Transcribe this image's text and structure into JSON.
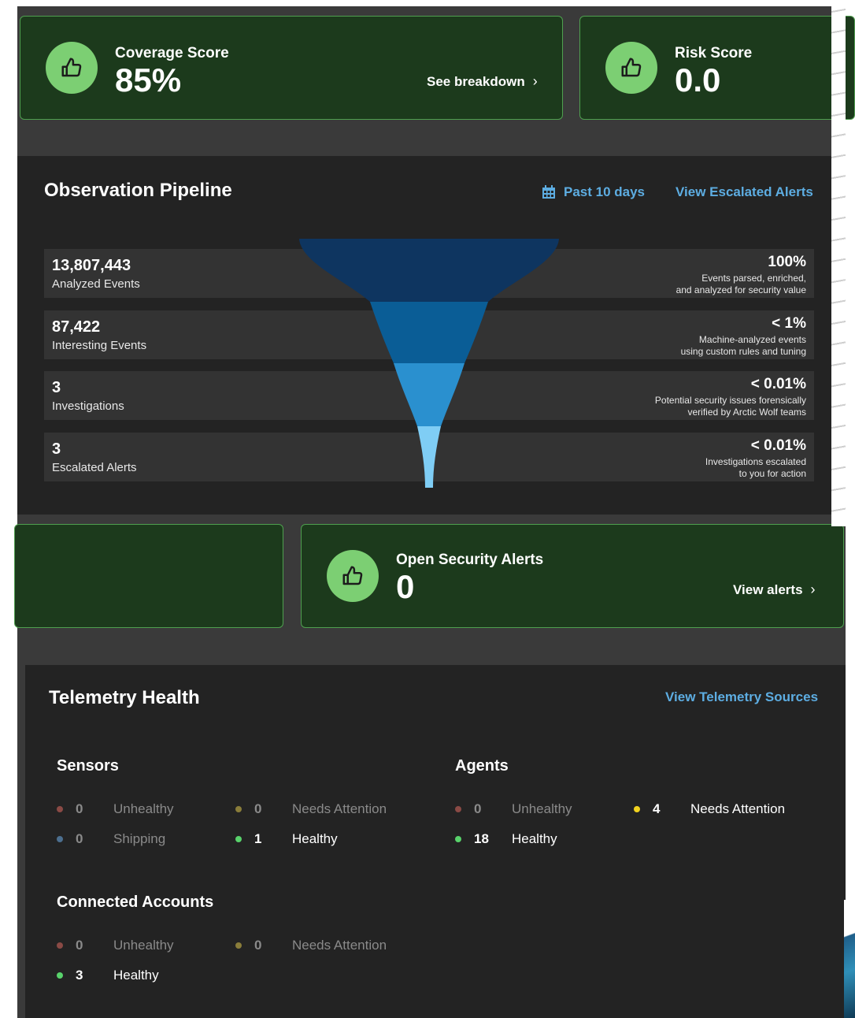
{
  "coverage_card": {
    "title": "Coverage Score",
    "value": "85%",
    "link": "See breakdown"
  },
  "risk_card": {
    "title": "Risk Score",
    "value": "0.0"
  },
  "pipeline": {
    "title": "Observation Pipeline",
    "date_range": "Past 10 days",
    "escalated_link": "View Escalated Alerts",
    "rows": [
      {
        "count": "13,807,443",
        "label": "Analyzed Events",
        "pct": "100%",
        "desc1": "Events parsed, enriched,",
        "desc2": "and analyzed for security value"
      },
      {
        "count": "87,422",
        "label": "Interesting Events",
        "pct": "< 1%",
        "desc1": "Machine-analyzed events",
        "desc2": "using custom rules and tuning"
      },
      {
        "count": "3",
        "label": "Investigations",
        "pct": "< 0.01%",
        "desc1": "Potential security issues forensically",
        "desc2": "verified by Arctic Wolf teams"
      },
      {
        "count": "3",
        "label": "Escalated Alerts",
        "pct": "< 0.01%",
        "desc1": "Investigations escalated",
        "desc2": "to you for action"
      }
    ],
    "funnel_colors": [
      "#0e3560",
      "#0a5d96",
      "#2a90cf",
      "#7fcdf5"
    ]
  },
  "alerts_card": {
    "title": "Open Security Alerts",
    "value": "0",
    "link": "View alerts"
  },
  "telemetry": {
    "title": "Telemetry Health",
    "sources_link": "View Telemetry Sources",
    "sensors": {
      "title": "Sensors",
      "unhealthy": {
        "count": "0",
        "label": "Unhealthy"
      },
      "needs_attention": {
        "count": "0",
        "label": "Needs Attention"
      },
      "shipping": {
        "count": "0",
        "label": "Shipping"
      },
      "healthy": {
        "count": "1",
        "label": "Healthy"
      }
    },
    "agents": {
      "title": "Agents",
      "unhealthy": {
        "count": "0",
        "label": "Unhealthy"
      },
      "needs_attention": {
        "count": "4",
        "label": "Needs Attention"
      },
      "healthy": {
        "count": "18",
        "label": "Healthy"
      }
    },
    "accounts": {
      "title": "Connected Accounts",
      "unhealthy": {
        "count": "0",
        "label": "Unhealthy"
      },
      "needs_attention": {
        "count": "0",
        "label": "Needs Attention"
      },
      "healthy": {
        "count": "3",
        "label": "Healthy"
      }
    }
  },
  "colors": {
    "accent_link": "#5dade2",
    "card_bg": "#1c3a1c",
    "card_border": "#4f9f4f",
    "thumb": "#7ccf73",
    "unhealthy": "#c0392b",
    "needs_attention": "#f1c40f",
    "shipping": "#5b9bd5",
    "healthy": "#58d26b"
  }
}
